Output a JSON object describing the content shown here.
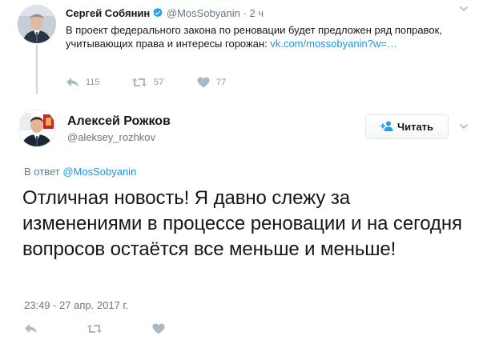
{
  "parent_tweet": {
    "author_name": "Сергей Собянин",
    "author_handle": "@MosSobyanin",
    "separator": "·",
    "time": "2 ч",
    "text": "В проект федерального закона по реновации будет предложен ряд поправок, учитывающих права и интересы горожан: ",
    "link_text": "vk.com/mossobyanin?w=…",
    "reply_count": "115",
    "retweet_count": "57",
    "like_count": "77"
  },
  "focused_tweet": {
    "author_name": "Алексей Рожков",
    "author_handle": "@aleksey_rozhkov",
    "follow_label": "Читать",
    "reply_prefix": "В ответ",
    "reply_mention": "@MosSobyanin",
    "text": "Отличная новость! Я давно слежу за изменениями в процессе реновации и на сегодня вопросов остаётся все меньше и меньше!",
    "timestamp": "23:49 - 27 апр. 2017 г."
  },
  "icons": {
    "verified": "verified-badge-icon",
    "more": "chevron-down-icon",
    "reply": "reply-icon",
    "retweet": "retweet-icon",
    "like": "heart-icon",
    "follow": "follow-person-plus-icon"
  },
  "colors": {
    "link": "#1b95e0",
    "muted": "#657786",
    "icon": "#aab8c2",
    "text": "#14171a"
  }
}
